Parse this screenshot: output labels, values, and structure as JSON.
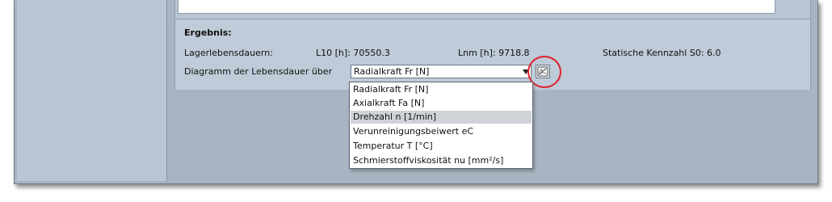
{
  "result": {
    "heading": "Ergebnis:",
    "lifetimes_label": "Lagerlebensdauern:",
    "l10": "L10 [h]: 70550.3",
    "lnm": "Lnm [h]: 9718.8",
    "s0": "Statische Kennzahl S0: 6.0",
    "diagram_label": "Diagramm der Lebensdauer über",
    "selected": "Radialkraft Fr [N]"
  },
  "dropdown": {
    "options": [
      "Radialkraft Fr [N]",
      "Axialkraft Fa [N]",
      "Drehzahl n [1/min]",
      "Verunreinigungsbeiwert eC",
      "Temperatur T [°C]",
      "Schmierstoffviskosität nu [mm²/s]"
    ],
    "highlighted_index": 2
  },
  "icons": {
    "combo_arrow": "chevron-down-icon",
    "diagram_button": "line-chart-icon"
  },
  "colors": {
    "annotation_circle": "#e0202a",
    "highlight": "#cfd3d8"
  }
}
